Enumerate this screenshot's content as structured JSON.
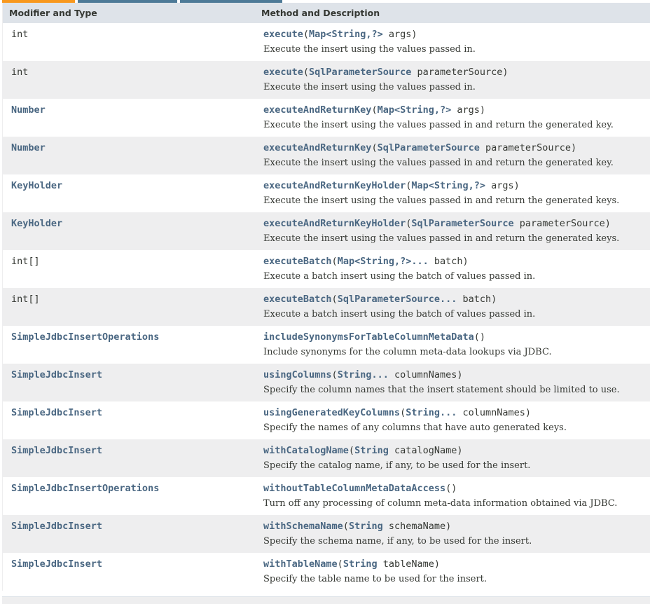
{
  "header": {
    "col1": "Modifier and Type",
    "col2": "Method and Description"
  },
  "rows": [
    {
      "type": "int",
      "type_link": false,
      "method": "execute",
      "params": [
        [
          "Map<String,?>",
          "args"
        ]
      ],
      "varargs": false,
      "desc": "Execute the insert using the values passed in."
    },
    {
      "type": "int",
      "type_link": false,
      "method": "execute",
      "params": [
        [
          "SqlParameterSource",
          "parameterSource"
        ]
      ],
      "varargs": false,
      "desc": "Execute the insert using the values passed in."
    },
    {
      "type": "Number",
      "type_link": true,
      "method": "executeAndReturnKey",
      "params": [
        [
          "Map<String,?>",
          "args"
        ]
      ],
      "varargs": false,
      "desc": "Execute the insert using the values passed in and return the generated key."
    },
    {
      "type": "Number",
      "type_link": true,
      "method": "executeAndReturnKey",
      "params": [
        [
          "SqlParameterSource",
          "parameterSource"
        ]
      ],
      "varargs": false,
      "desc": "Execute the insert using the values passed in and return the generated key."
    },
    {
      "type": "KeyHolder",
      "type_link": true,
      "method": "executeAndReturnKeyHolder",
      "params": [
        [
          "Map<String,?>",
          "args"
        ]
      ],
      "varargs": false,
      "desc": "Execute the insert using the values passed in and return the generated keys."
    },
    {
      "type": "KeyHolder",
      "type_link": true,
      "method": "executeAndReturnKeyHolder",
      "params": [
        [
          "SqlParameterSource",
          "parameterSource"
        ]
      ],
      "varargs": false,
      "desc": "Execute the insert using the values passed in and return the generated keys."
    },
    {
      "type": "int[]",
      "type_link": false,
      "method": "executeBatch",
      "params": [
        [
          "Map<String,?>...",
          "batch"
        ]
      ],
      "varargs": true,
      "desc": "Execute a batch insert using the batch of values passed in."
    },
    {
      "type": "int[]",
      "type_link": false,
      "method": "executeBatch",
      "params": [
        [
          "SqlParameterSource...",
          "batch"
        ]
      ],
      "varargs": true,
      "desc": "Execute a batch insert using the batch of values passed in."
    },
    {
      "type": "SimpleJdbcInsertOperations",
      "type_link": true,
      "method": "includeSynonymsForTableColumnMetaData",
      "params": [],
      "varargs": false,
      "desc": "Include synonyms for the column meta-data lookups via JDBC."
    },
    {
      "type": "SimpleJdbcInsert",
      "type_link": true,
      "method": "usingColumns",
      "params": [
        [
          "String...",
          "columnNames"
        ]
      ],
      "varargs": true,
      "desc": "Specify the column names that the insert statement should be limited to use."
    },
    {
      "type": "SimpleJdbcInsert",
      "type_link": true,
      "method": "usingGeneratedKeyColumns",
      "params": [
        [
          "String...",
          "columnNames"
        ]
      ],
      "varargs": true,
      "desc": "Specify the names of any columns that have auto generated keys."
    },
    {
      "type": "SimpleJdbcInsert",
      "type_link": true,
      "method": "withCatalogName",
      "params": [
        [
          "String",
          "catalogName"
        ]
      ],
      "varargs": false,
      "desc": "Specify the catalog name, if any, to be used for the insert."
    },
    {
      "type": "SimpleJdbcInsertOperations",
      "type_link": true,
      "method": "withoutTableColumnMetaDataAccess",
      "params": [],
      "varargs": false,
      "desc": "Turn off any processing of column meta-data information obtained via JDBC."
    },
    {
      "type": "SimpleJdbcInsert",
      "type_link": true,
      "method": "withSchemaName",
      "params": [
        [
          "String",
          "schemaName"
        ]
      ],
      "varargs": false,
      "desc": "Specify the schema name, if any, to be used for the insert."
    },
    {
      "type": "SimpleJdbcInsert",
      "type_link": true,
      "method": "withTableName",
      "params": [
        [
          "String",
          "tableName"
        ]
      ],
      "varargs": false,
      "desc": "Specify the table name to be used for the insert."
    }
  ],
  "colors": {
    "link": "#4a6782",
    "text": "#353833",
    "header_bg": "#dee3e9",
    "alt_row_bg": "#eeeeef",
    "tab_active": "#f8981d",
    "tab_inactive": "#4d7a97"
  }
}
